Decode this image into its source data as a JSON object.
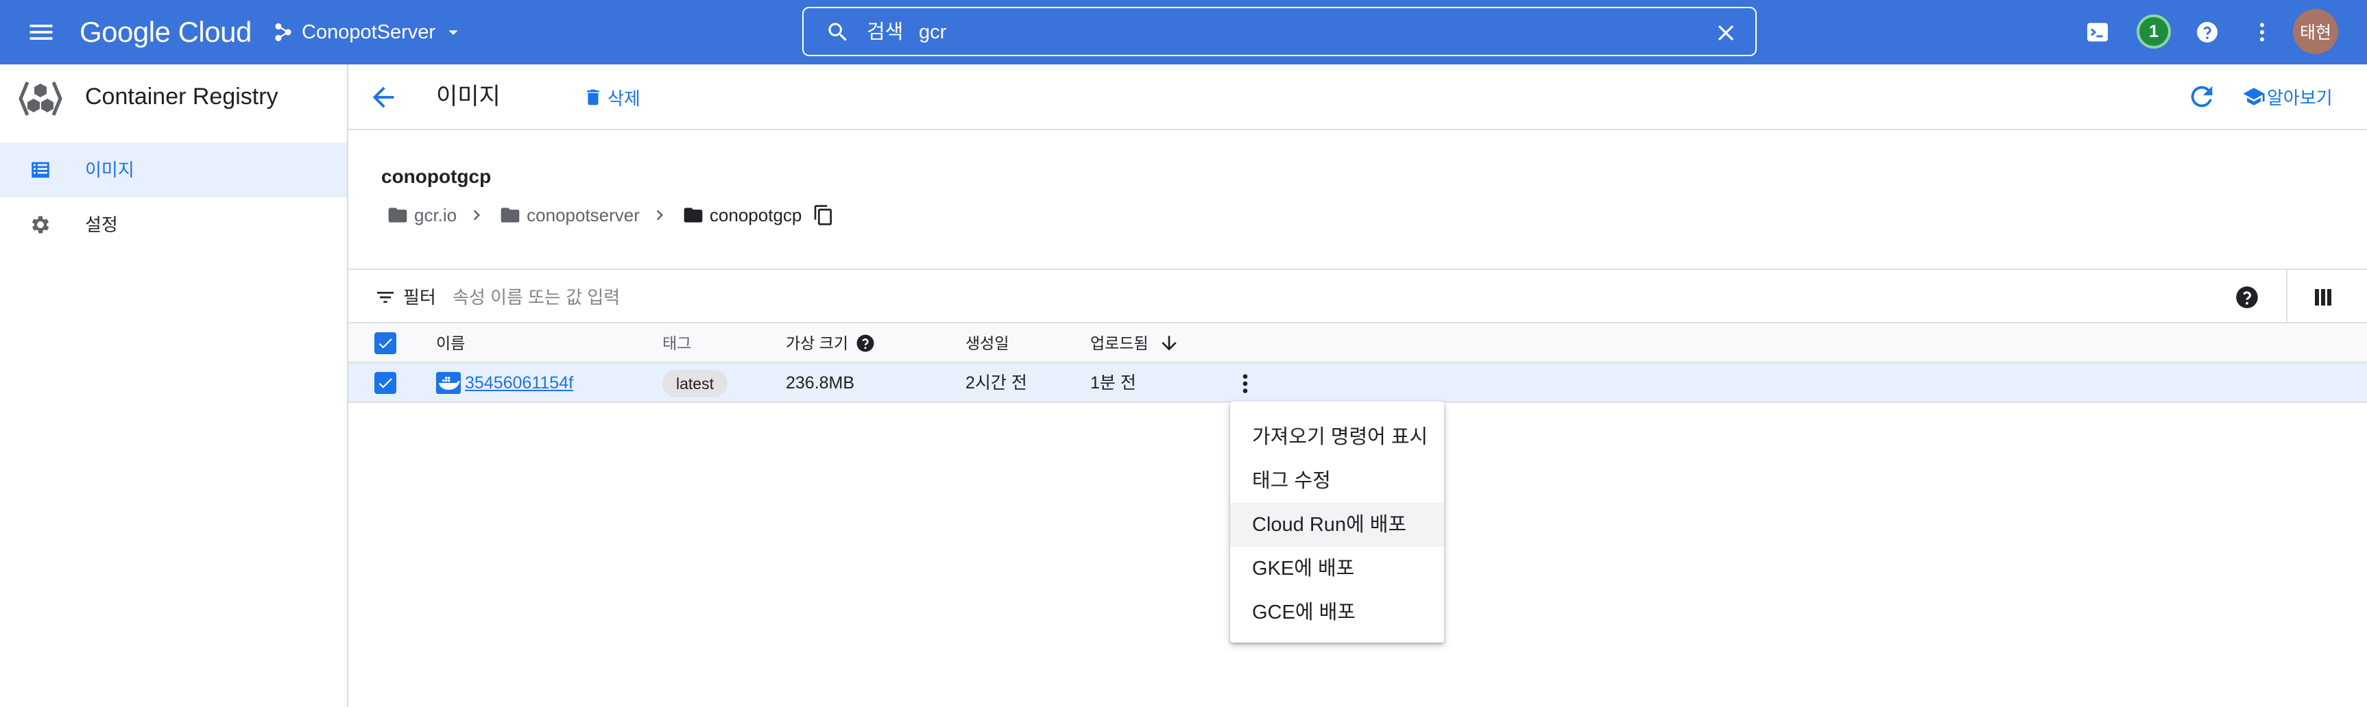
{
  "topbar": {
    "menu_icon": "hamburger-menu-icon",
    "logo_text": "Google Cloud",
    "project_name": "ConopotServer",
    "search": {
      "label": "검색",
      "value": "gcr"
    },
    "notification_count": "1",
    "avatar_text": "태현",
    "bar_color": "#3a73d9"
  },
  "sidebar": {
    "product_title": "Container Registry",
    "items": [
      {
        "label": "이미지",
        "icon": "list-icon",
        "active": true
      },
      {
        "label": "설정",
        "icon": "gear-icon",
        "active": false
      }
    ]
  },
  "actionbar": {
    "title": "이미지",
    "delete_label": "삭제",
    "learn_label": "알아보기"
  },
  "repository": {
    "name": "conopotgcp",
    "breadcrumbs": [
      "gcr.io",
      "conopotserver",
      "conopotgcp"
    ]
  },
  "filter": {
    "label": "필터",
    "placeholder": "속성 이름 또는 값 입력"
  },
  "table": {
    "headers": {
      "name": "이름",
      "tag": "태그",
      "virtual_size": "가상 크기",
      "created": "생성일",
      "uploaded": "업로드됨"
    },
    "rows": [
      {
        "name": "35456061154f",
        "tag": "latest",
        "virtual_size": "236.8MB",
        "created": "2시간 전",
        "uploaded": "1분 전",
        "selected": true
      }
    ]
  },
  "context_menu": {
    "items": [
      "가져오기 명령어 표시",
      "태그 수정",
      "Cloud Run에 배포",
      "GKE에 배포",
      "GCE에 배포"
    ],
    "highlighted_index": 2
  },
  "colors": {
    "accent": "#1a73e8",
    "selected_row": "#e8f0fe",
    "badge_green": "#1e8e3e",
    "avatar": "#a77466"
  }
}
